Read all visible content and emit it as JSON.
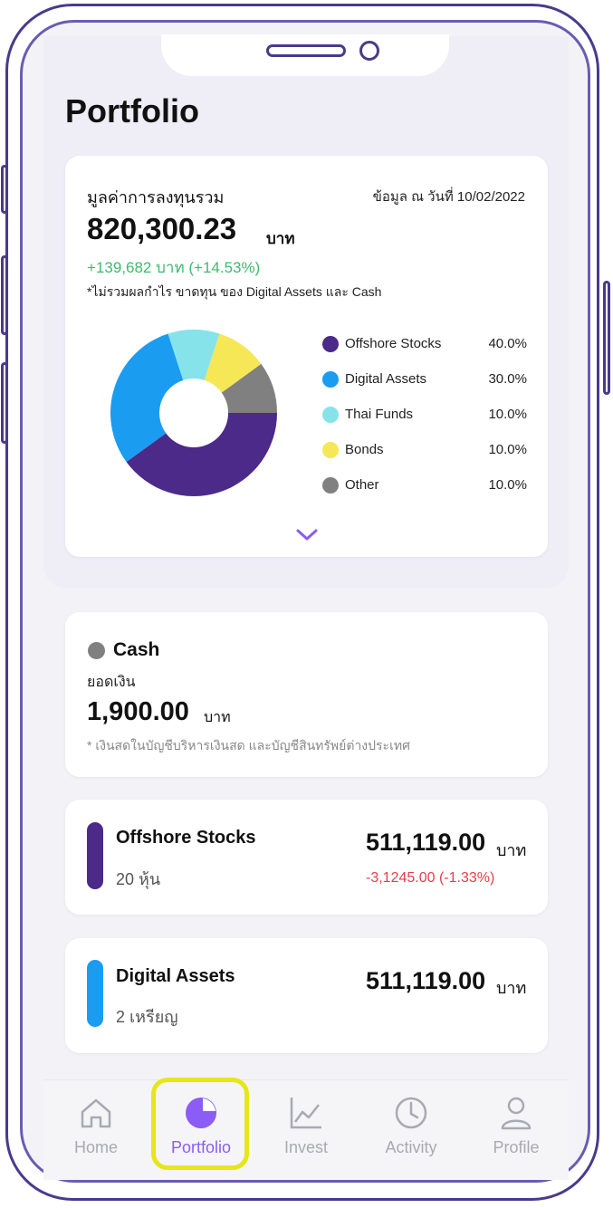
{
  "page": {
    "title": "Portfolio"
  },
  "summary": {
    "label": "มูลค่าการลงทุนรวม",
    "date": "ข้อมูล ณ วันที่ 10/02/2022",
    "total": "820,300.23",
    "unit": "บาท",
    "change": "+139,682 บาท (+14.53%)",
    "note": "*ไม่รวมผลกำไร ขาดทุน ของ Digital Assets และ Cash"
  },
  "chart_data": {
    "type": "pie",
    "categories": [
      "Offshore Stocks",
      "Digital Assets",
      "Thai Funds",
      "Bonds",
      "Other"
    ],
    "values": [
      40.0,
      30.0,
      10.0,
      10.0,
      10.0
    ],
    "percent_labels": [
      "40.0%",
      "30.0%",
      "10.0%",
      "10.0%",
      "10.0%"
    ],
    "colors": [
      "#4b2a8a",
      "#1a9cf0",
      "#86e3ea",
      "#f6e756",
      "#808080"
    ],
    "legend_position": "right"
  },
  "colors": {
    "accent": "#8b5cf6",
    "positive": "#3dba6e",
    "negative": "#e53e4a",
    "offshore": "#4b2a8a",
    "digital": "#1a9cf0",
    "cash": "#808080"
  },
  "cash": {
    "title": "Cash",
    "label": "ยอดเงิน",
    "amount": "1,900.00",
    "unit": "บาท",
    "note": "* เงินสดในบัญชีบริหารเงินสด และบัญชีสินทรัพย์ต่างประเทศ"
  },
  "holdings": [
    {
      "name": "Offshore Stocks",
      "count": "20 หุ้น",
      "amount": "511,119.00",
      "unit": "บาท",
      "change": "-3,1245.00 (-1.33%)"
    },
    {
      "name": "Digital Assets",
      "count": "2  เหรียญ",
      "amount": "511,119.00",
      "unit": "บาท"
    }
  ],
  "nav": [
    {
      "label": "Home",
      "icon": "home-icon"
    },
    {
      "label": "Portfolio",
      "icon": "pie-chart-icon",
      "active": true
    },
    {
      "label": "Invest",
      "icon": "line-chart-icon"
    },
    {
      "label": "Activity",
      "icon": "clock-icon"
    },
    {
      "label": "Profile",
      "icon": "user-icon"
    }
  ]
}
